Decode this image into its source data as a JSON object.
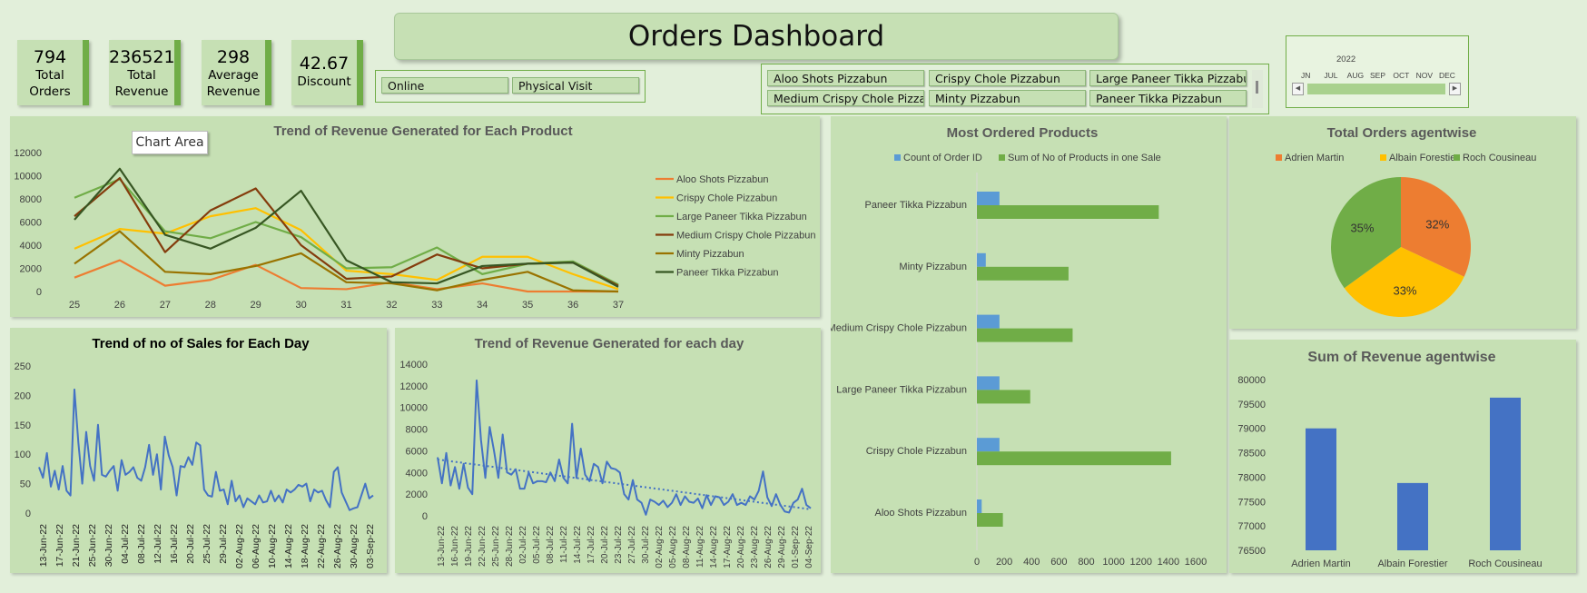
{
  "kpis": [
    {
      "value": "794",
      "label1": "Total",
      "label2": "Orders"
    },
    {
      "value": "236521",
      "label1": "Total",
      "label2": "Revenue"
    },
    {
      "value": "298",
      "label1": "Average",
      "label2": "Revenue"
    },
    {
      "value": "42.67",
      "label1": "Discount",
      "label2": ""
    }
  ],
  "dashboard_title": "Orders Dashboard",
  "order_type_slicer": [
    "Online",
    "Physical Visit"
  ],
  "product_slicer": [
    "Aloo Shots Pizzabun",
    "Crispy Chole Pizzabun",
    "Large Paneer Tikka Pizzabun",
    "Medium Crispy Chole Pizzab…",
    "Minty Pizzabun",
    "Paneer Tikka Pizzabun"
  ],
  "timeline": {
    "year": "2022",
    "months": [
      "JN",
      "JUL",
      "AUG",
      "SEP",
      "OCT",
      "NOV",
      "DEC"
    ],
    "fill_color": "#a9d18e"
  },
  "tooltip": "Chart Area",
  "colors": {
    "green": "#70ad47",
    "dark_green": "#375623",
    "blue": "#4472c4",
    "light_blue": "#5b9bd5",
    "orange": "#ed7d31",
    "gold": "#ffc000",
    "brown": "#843c0c",
    "olive": "#997300",
    "panel": "#c6e0b4",
    "bg": "#e2efda"
  },
  "chart_data": [
    {
      "id": "product_trend",
      "type": "line",
      "title": "Trend of Revenue Generated for Each Product",
      "x": [
        "25",
        "26",
        "27",
        "28",
        "29",
        "30",
        "31",
        "32",
        "33",
        "34",
        "35",
        "36",
        "37"
      ],
      "ylim": [
        0,
        12000
      ],
      "yticks": [
        "0",
        "2000",
        "4000",
        "6000",
        "8000",
        "10000",
        "12000"
      ],
      "legend_position": "right",
      "series": [
        {
          "name": "Aloo Shots Pizzabun",
          "color": "#ed7d31",
          "values": [
            1200,
            2700,
            500,
            1000,
            2300,
            300,
            200,
            800,
            200,
            700,
            0,
            0,
            0
          ]
        },
        {
          "name": "Crispy Chole Pizzabun",
          "color": "#ffc000",
          "values": [
            3700,
            5400,
            5000,
            6500,
            7200,
            5300,
            1800,
            1500,
            1000,
            3000,
            3000,
            1500,
            200
          ]
        },
        {
          "name": "Large Paneer Tikka Pizzabun",
          "color": "#70ad47",
          "values": [
            8100,
            9700,
            5200,
            4600,
            6000,
            4700,
            2000,
            2100,
            3800,
            1500,
            2400,
            2600,
            600
          ]
        },
        {
          "name": "Medium Crispy Chole Pizzabun",
          "color": "#843c0c",
          "values": [
            6500,
            9800,
            3400,
            7000,
            8900,
            4000,
            1100,
            1300,
            3200,
            2000,
            2400,
            2500,
            500
          ]
        },
        {
          "name": "Minty Pizzabun",
          "color": "#997300",
          "values": [
            2400,
            5200,
            1700,
            1500,
            2200,
            3300,
            800,
            700,
            100,
            1000,
            1700,
            100,
            0
          ]
        },
        {
          "name": "Paneer Tikka Pizzabun",
          "color": "#375623",
          "values": [
            6200,
            10600,
            4900,
            3700,
            5500,
            8700,
            2700,
            800,
            700,
            2200,
            2400,
            2500,
            400
          ]
        }
      ]
    },
    {
      "id": "most_ordered",
      "type": "bar",
      "title": "Most Ordered Products",
      "categories": [
        "Paneer Tikka Pizzabun",
        "Minty Pizzabun",
        "Medium Crispy Chole Pizzabun",
        "Large Paneer Tikka Pizzabun",
        "Crispy Chole Pizzabun",
        "Aloo Shots Pizzabun"
      ],
      "xlim": [
        0,
        1600
      ],
      "xticks": [
        "0",
        "200",
        "400",
        "600",
        "800",
        "1000",
        "1200",
        "1400",
        "1600"
      ],
      "legend_position": "top",
      "series": [
        {
          "name": "Count of Order ID",
          "color": "#5b9bd5",
          "values": [
            165,
            65,
            165,
            165,
            165,
            35
          ]
        },
        {
          "name": "Sum of No of Products in one Sale",
          "color": "#70ad47",
          "values": [
            1330,
            670,
            700,
            390,
            1420,
            190
          ]
        }
      ]
    },
    {
      "id": "orders_agentwise",
      "type": "pie",
      "title": "Total Orders agentwise",
      "legend_position": "top",
      "series": [
        {
          "name": "Adrien Martin",
          "color": "#ed7d31",
          "value": 32,
          "label": "32%"
        },
        {
          "name": "Albain Forestier",
          "color": "#ffc000",
          "value": 33,
          "label": "33%"
        },
        {
          "name": "Roch Cousineau",
          "color": "#70ad47",
          "value": 35,
          "label": "35%"
        }
      ]
    },
    {
      "id": "sales_per_day",
      "type": "line",
      "title": "Trend of no of Sales for Each Day",
      "ylim": [
        0,
        250
      ],
      "yticks": [
        "0",
        "50",
        "100",
        "150",
        "200",
        "250"
      ],
      "xticks": [
        "13-Jun-22",
        "17-Jun-22",
        "21-Jun-22",
        "25-Jun-22",
        "30-Jun-22",
        "04-Jul-22",
        "08-Jul-22",
        "12-Jul-22",
        "16-Jul-22",
        "20-Jul-22",
        "25-Jul-22",
        "29-Jul-22",
        "02-Aug-22",
        "06-Aug-22",
        "10-Aug-22",
        "14-Aug-22",
        "18-Aug-22",
        "22-Aug-22",
        "26-Aug-22",
        "30-Aug-22",
        "03-Sep-22"
      ],
      "values": [
        78,
        60,
        102,
        45,
        72,
        40,
        80,
        38,
        30,
        210,
        120,
        50,
        138,
        80,
        55,
        150,
        65,
        62,
        72,
        80,
        38,
        90,
        65,
        70,
        78,
        60,
        55,
        78,
        116,
        65,
        100,
        40,
        130,
        98,
        78,
        30,
        80,
        78,
        95,
        82,
        120,
        115,
        40,
        30,
        28,
        70,
        38,
        40,
        15,
        55,
        20,
        30,
        10,
        25,
        20,
        15,
        30,
        18,
        20,
        38,
        20,
        30,
        18,
        40,
        35,
        40,
        48,
        45,
        50,
        20,
        40,
        35,
        38,
        22,
        10,
        70,
        78,
        35,
        20,
        5,
        8,
        10,
        30,
        50,
        25,
        30
      ],
      "color": "#4472c4"
    },
    {
      "id": "revenue_per_day",
      "type": "line",
      "title": "Trend of Revenue Generated for each day",
      "ylim": [
        0,
        14000
      ],
      "yticks": [
        "0",
        "2000",
        "4000",
        "6000",
        "8000",
        "10000",
        "12000",
        "14000"
      ],
      "xticks": [
        "13-Jun-22",
        "16-Jun-22",
        "19-Jun-22",
        "22-Jun-22",
        "25-Jun-22",
        "28-Jun-22",
        "02-Jul-22",
        "05-Jul-22",
        "08-Jul-22",
        "11-Jul-22",
        "14-Jul-22",
        "17-Jul-22",
        "20-Jul-22",
        "23-Jul-22",
        "27-Jul-22",
        "30-Jul-22",
        "02-Aug-22",
        "05-Aug-22",
        "08-Aug-22",
        "11-Aug-22",
        "14-Aug-22",
        "17-Aug-22",
        "20-Aug-22",
        "23-Aug-22",
        "26-Aug-22",
        "29-Aug-22",
        "01-Sep-22",
        "04-Sep-22"
      ],
      "values": [
        5400,
        3000,
        5800,
        2800,
        4500,
        2500,
        4800,
        2600,
        2000,
        12500,
        7000,
        3500,
        8200,
        6000,
        3500,
        7500,
        4000,
        3800,
        4300,
        2500,
        2500,
        4000,
        3000,
        3200,
        3200,
        3100,
        4000,
        3200,
        5200,
        3500,
        3000,
        8500,
        3500,
        6200,
        3800,
        3200,
        4800,
        4500,
        3000,
        5000,
        4400,
        4300,
        4000,
        2000,
        1500,
        3300,
        1500,
        1200,
        100,
        1500,
        1300,
        1000,
        1400,
        800,
        1200,
        2000,
        1000,
        1800,
        1300,
        1200,
        1600,
        700,
        1900,
        1000,
        1800,
        1700,
        1000,
        1300,
        2000,
        1000,
        1200,
        1000,
        1800,
        1500,
        2300,
        4100,
        1700,
        900,
        2000,
        1000,
        400,
        300,
        1200,
        1500,
        2500,
        1000,
        700
      ],
      "trendline": [
        5200,
        600
      ],
      "color": "#4472c4"
    },
    {
      "id": "revenue_agentwise",
      "type": "bar",
      "title": "Sum of Revenue agentwise",
      "categories": [
        "Adrien Martin",
        "Albain Forestier",
        "Roch Cousineau"
      ],
      "values": [
        79000,
        77880,
        79630
      ],
      "ylim": [
        76500,
        80000
      ],
      "yticks": [
        "76500",
        "77000",
        "77500",
        "78000",
        "78500",
        "79000",
        "79500",
        "80000"
      ],
      "color": "#4472c4"
    }
  ]
}
